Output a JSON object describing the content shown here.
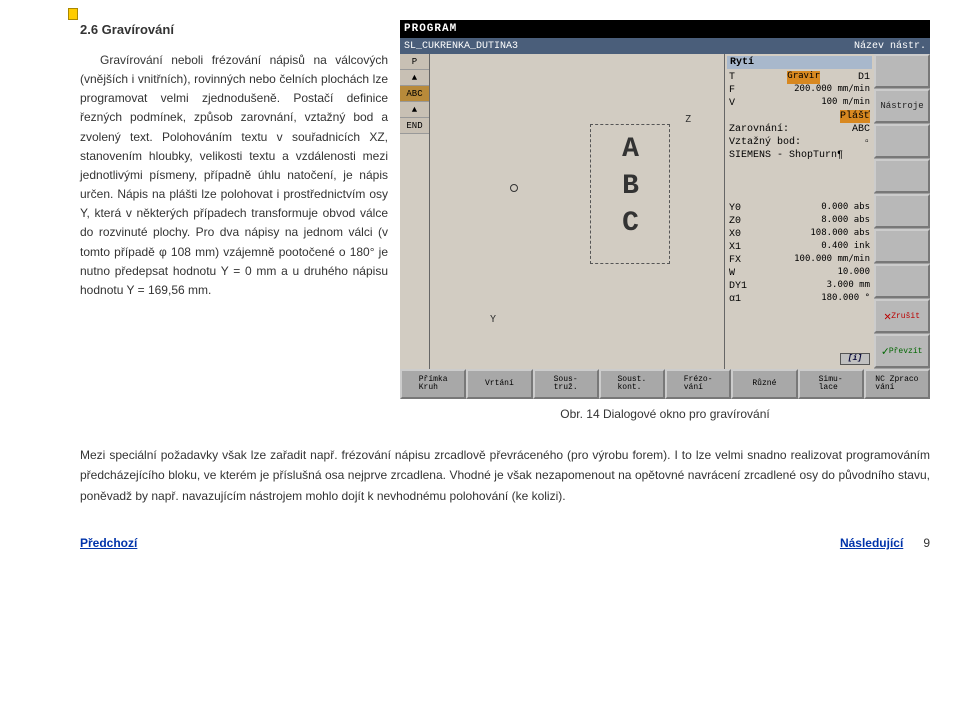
{
  "heading": "2.6 Gravírování",
  "paragraph": "Gravírování neboli frézování nápisů na válcových (vnějších i vnitřních), rovinných nebo čelních plochách lze programovat velmi zjednodušeně. Postačí definice řezných podmínek, způsob zarovnání, vztažný bod a zvolený text. Polohováním textu v souřadnicích XZ, stanovením hloubky, velikosti textu a vzdálenosti mezi jednotlivými písmeny, případně úhlu natočení, je nápis určen. Nápis na plášti lze polohovat i prostřednictvím osy Y, která v některých případech transformuje obvod válce do rozvinuté plochy. Pro dva nápisy na jednom válci (v tomto případě φ 108 mm) vzájemně pootočené o 180° je nutno předepsat hodnotu Y = 0 mm a u druhého nápisu hodnotu Y = 169,56 mm.",
  "lower": "Mezi speciální požadavky však lze zařadit např. frézování nápisu zrcadlově převráceného (pro výrobu forem). I to lze velmi snadno realizovat programováním předcházejícího bloku, ve kterém je příslušná osa nejprve zrcadlena. Vhodné je však nezapomenout na opětovné navrácení zrcadlené osy do původního stavu, poněvadž by např. navazujícím nástrojem mohlo dojít k nevhodnému polohování (ke kolizi).",
  "nav": {
    "prev": "Předchozí",
    "next": "Následující",
    "page": "9"
  },
  "caption": "Obr. 14  Dialogové okno pro gravírování",
  "cnc": {
    "header": "PROGRAM",
    "title_left": "SL_CUKRENKA_DUTINA3",
    "title_right": "Název nástr.",
    "left_items": [
      "P",
      "▲",
      "ABC",
      "▲",
      "END"
    ],
    "canvas": {
      "z": "Z",
      "y": "Y",
      "abc": "ABC"
    },
    "section1": "Rytí",
    "params1": [
      {
        "l": "T",
        "v": "Gravir",
        "suffix": "D1",
        "hl": true
      },
      {
        "l": "F",
        "v": "200.000 mm/min"
      },
      {
        "l": "V",
        "v": "100 m/min"
      }
    ],
    "plast": "Plášť",
    "zarovnani": {
      "l": "Zarovnání:",
      "v": "ABC"
    },
    "vztazny": {
      "l": "Vztažný bod:",
      "v": "▫"
    },
    "siemens": "SIEMENS - ShopTurn¶",
    "params2": [
      {
        "l": "Y0",
        "v": "0.000 abs"
      },
      {
        "l": "Z0",
        "v": "8.000 abs"
      },
      {
        "l": "X0",
        "v": "108.000 abs"
      },
      {
        "l": "X1",
        "v": "0.400 ink"
      },
      {
        "l": "FX",
        "v": "100.000 mm/min"
      },
      {
        "l": "W",
        "v": "10.000"
      },
      {
        "l": "DY1",
        "v": "3.000 mm"
      },
      {
        "l": "α1",
        "v": "180.000 °"
      }
    ],
    "sidebar": [
      "",
      "Nástroje",
      "",
      "",
      "",
      "",
      "",
      "Zrušit",
      "Převzít"
    ],
    "info": "[i]",
    "bottom": [
      "Přímka\nKruh",
      "Vrtání",
      "Sous-\ntruž.",
      "Soust.\nkont.",
      "Frézo-\nvání",
      "Různé",
      "Simu-\nlace",
      "NC  Zpraco\nvání"
    ]
  }
}
